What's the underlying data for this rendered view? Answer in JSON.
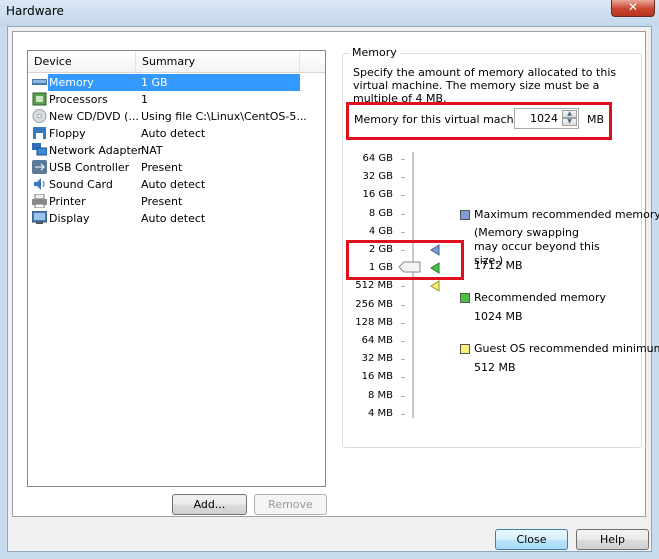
{
  "window": {
    "title": "Hardware",
    "close_glyph": "✕"
  },
  "device_list": {
    "columns": [
      "Device",
      "Summary"
    ],
    "rows": [
      {
        "icon": "memory-icon",
        "device": "Memory",
        "summary": "1 GB",
        "selected": true
      },
      {
        "icon": "processor-icon",
        "device": "Processors",
        "summary": "1"
      },
      {
        "icon": "cd-dvd-icon",
        "device": "New CD/DVD (...",
        "summary": "Using file C:\\Linux\\CentOS-5..."
      },
      {
        "icon": "floppy-icon",
        "device": "Floppy",
        "summary": "Auto detect"
      },
      {
        "icon": "network-adapter-icon",
        "device": "Network Adapter",
        "summary": "NAT"
      },
      {
        "icon": "usb-icon",
        "device": "USB Controller",
        "summary": "Present"
      },
      {
        "icon": "sound-card-icon",
        "device": "Sound Card",
        "summary": "Auto detect"
      },
      {
        "icon": "printer-icon",
        "device": "Printer",
        "summary": "Present"
      },
      {
        "icon": "display-icon",
        "device": "Display",
        "summary": "Auto detect"
      }
    ]
  },
  "buttons": {
    "add": "Add...",
    "remove": "Remove",
    "close": "Close",
    "help": "Help"
  },
  "memory": {
    "group_title": "Memory",
    "description": "Specify the amount of memory allocated to this virtual machine. The memory size must be a multiple of 4 MB.",
    "field_label": "Memory for this virtual machine:",
    "value": "1024",
    "unit": "MB",
    "scale": [
      "64 GB",
      "32 GB",
      "16 GB",
      "8 GB",
      "4 GB",
      "2 GB",
      "1 GB",
      "512 MB",
      "256 MB",
      "128 MB",
      "64 MB",
      "32 MB",
      "16 MB",
      "8 MB",
      "4 MB"
    ],
    "slider_value": "1 GB",
    "markers": {
      "max_recommended": "2 GB",
      "recommended": "1 GB",
      "guest_min": "512 MB"
    },
    "legend": [
      {
        "color": "#7c9ed0",
        "label": "Maximum recommended memory",
        "note": "(Memory swapping may occur beyond this size.)",
        "value": "1712 MB"
      },
      {
        "color": "#4cc043",
        "label": "Recommended memory",
        "value": "1024 MB"
      },
      {
        "color": "#f4f07a",
        "label": "Guest OS recommended minimum",
        "value": "512 MB"
      }
    ]
  }
}
